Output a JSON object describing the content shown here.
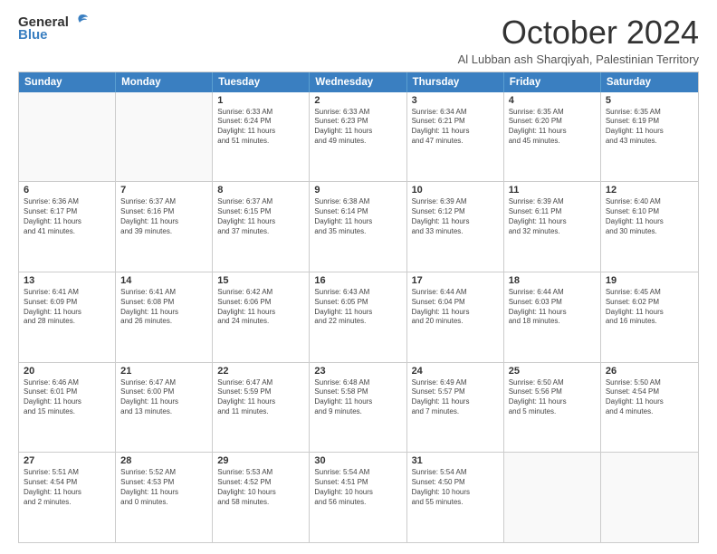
{
  "header": {
    "logo_general": "General",
    "logo_blue": "Blue",
    "month_title": "October 2024",
    "subtitle": "Al Lubban ash Sharqiyah, Palestinian Territory"
  },
  "days_of_week": [
    "Sunday",
    "Monday",
    "Tuesday",
    "Wednesday",
    "Thursday",
    "Friday",
    "Saturday"
  ],
  "weeks": [
    [
      {
        "day": "",
        "lines": []
      },
      {
        "day": "",
        "lines": []
      },
      {
        "day": "1",
        "lines": [
          "Sunrise: 6:33 AM",
          "Sunset: 6:24 PM",
          "Daylight: 11 hours",
          "and 51 minutes."
        ]
      },
      {
        "day": "2",
        "lines": [
          "Sunrise: 6:33 AM",
          "Sunset: 6:23 PM",
          "Daylight: 11 hours",
          "and 49 minutes."
        ]
      },
      {
        "day": "3",
        "lines": [
          "Sunrise: 6:34 AM",
          "Sunset: 6:21 PM",
          "Daylight: 11 hours",
          "and 47 minutes."
        ]
      },
      {
        "day": "4",
        "lines": [
          "Sunrise: 6:35 AM",
          "Sunset: 6:20 PM",
          "Daylight: 11 hours",
          "and 45 minutes."
        ]
      },
      {
        "day": "5",
        "lines": [
          "Sunrise: 6:35 AM",
          "Sunset: 6:19 PM",
          "Daylight: 11 hours",
          "and 43 minutes."
        ]
      }
    ],
    [
      {
        "day": "6",
        "lines": [
          "Sunrise: 6:36 AM",
          "Sunset: 6:17 PM",
          "Daylight: 11 hours",
          "and 41 minutes."
        ]
      },
      {
        "day": "7",
        "lines": [
          "Sunrise: 6:37 AM",
          "Sunset: 6:16 PM",
          "Daylight: 11 hours",
          "and 39 minutes."
        ]
      },
      {
        "day": "8",
        "lines": [
          "Sunrise: 6:37 AM",
          "Sunset: 6:15 PM",
          "Daylight: 11 hours",
          "and 37 minutes."
        ]
      },
      {
        "day": "9",
        "lines": [
          "Sunrise: 6:38 AM",
          "Sunset: 6:14 PM",
          "Daylight: 11 hours",
          "and 35 minutes."
        ]
      },
      {
        "day": "10",
        "lines": [
          "Sunrise: 6:39 AM",
          "Sunset: 6:12 PM",
          "Daylight: 11 hours",
          "and 33 minutes."
        ]
      },
      {
        "day": "11",
        "lines": [
          "Sunrise: 6:39 AM",
          "Sunset: 6:11 PM",
          "Daylight: 11 hours",
          "and 32 minutes."
        ]
      },
      {
        "day": "12",
        "lines": [
          "Sunrise: 6:40 AM",
          "Sunset: 6:10 PM",
          "Daylight: 11 hours",
          "and 30 minutes."
        ]
      }
    ],
    [
      {
        "day": "13",
        "lines": [
          "Sunrise: 6:41 AM",
          "Sunset: 6:09 PM",
          "Daylight: 11 hours",
          "and 28 minutes."
        ]
      },
      {
        "day": "14",
        "lines": [
          "Sunrise: 6:41 AM",
          "Sunset: 6:08 PM",
          "Daylight: 11 hours",
          "and 26 minutes."
        ]
      },
      {
        "day": "15",
        "lines": [
          "Sunrise: 6:42 AM",
          "Sunset: 6:06 PM",
          "Daylight: 11 hours",
          "and 24 minutes."
        ]
      },
      {
        "day": "16",
        "lines": [
          "Sunrise: 6:43 AM",
          "Sunset: 6:05 PM",
          "Daylight: 11 hours",
          "and 22 minutes."
        ]
      },
      {
        "day": "17",
        "lines": [
          "Sunrise: 6:44 AM",
          "Sunset: 6:04 PM",
          "Daylight: 11 hours",
          "and 20 minutes."
        ]
      },
      {
        "day": "18",
        "lines": [
          "Sunrise: 6:44 AM",
          "Sunset: 6:03 PM",
          "Daylight: 11 hours",
          "and 18 minutes."
        ]
      },
      {
        "day": "19",
        "lines": [
          "Sunrise: 6:45 AM",
          "Sunset: 6:02 PM",
          "Daylight: 11 hours",
          "and 16 minutes."
        ]
      }
    ],
    [
      {
        "day": "20",
        "lines": [
          "Sunrise: 6:46 AM",
          "Sunset: 6:01 PM",
          "Daylight: 11 hours",
          "and 15 minutes."
        ]
      },
      {
        "day": "21",
        "lines": [
          "Sunrise: 6:47 AM",
          "Sunset: 6:00 PM",
          "Daylight: 11 hours",
          "and 13 minutes."
        ]
      },
      {
        "day": "22",
        "lines": [
          "Sunrise: 6:47 AM",
          "Sunset: 5:59 PM",
          "Daylight: 11 hours",
          "and 11 minutes."
        ]
      },
      {
        "day": "23",
        "lines": [
          "Sunrise: 6:48 AM",
          "Sunset: 5:58 PM",
          "Daylight: 11 hours",
          "and 9 minutes."
        ]
      },
      {
        "day": "24",
        "lines": [
          "Sunrise: 6:49 AM",
          "Sunset: 5:57 PM",
          "Daylight: 11 hours",
          "and 7 minutes."
        ]
      },
      {
        "day": "25",
        "lines": [
          "Sunrise: 6:50 AM",
          "Sunset: 5:56 PM",
          "Daylight: 11 hours",
          "and 5 minutes."
        ]
      },
      {
        "day": "26",
        "lines": [
          "Sunrise: 5:50 AM",
          "Sunset: 4:54 PM",
          "Daylight: 11 hours",
          "and 4 minutes."
        ]
      }
    ],
    [
      {
        "day": "27",
        "lines": [
          "Sunrise: 5:51 AM",
          "Sunset: 4:54 PM",
          "Daylight: 11 hours",
          "and 2 minutes."
        ]
      },
      {
        "day": "28",
        "lines": [
          "Sunrise: 5:52 AM",
          "Sunset: 4:53 PM",
          "Daylight: 11 hours",
          "and 0 minutes."
        ]
      },
      {
        "day": "29",
        "lines": [
          "Sunrise: 5:53 AM",
          "Sunset: 4:52 PM",
          "Daylight: 10 hours",
          "and 58 minutes."
        ]
      },
      {
        "day": "30",
        "lines": [
          "Sunrise: 5:54 AM",
          "Sunset: 4:51 PM",
          "Daylight: 10 hours",
          "and 56 minutes."
        ]
      },
      {
        "day": "31",
        "lines": [
          "Sunrise: 5:54 AM",
          "Sunset: 4:50 PM",
          "Daylight: 10 hours",
          "and 55 minutes."
        ]
      },
      {
        "day": "",
        "lines": []
      },
      {
        "day": "",
        "lines": []
      }
    ]
  ]
}
